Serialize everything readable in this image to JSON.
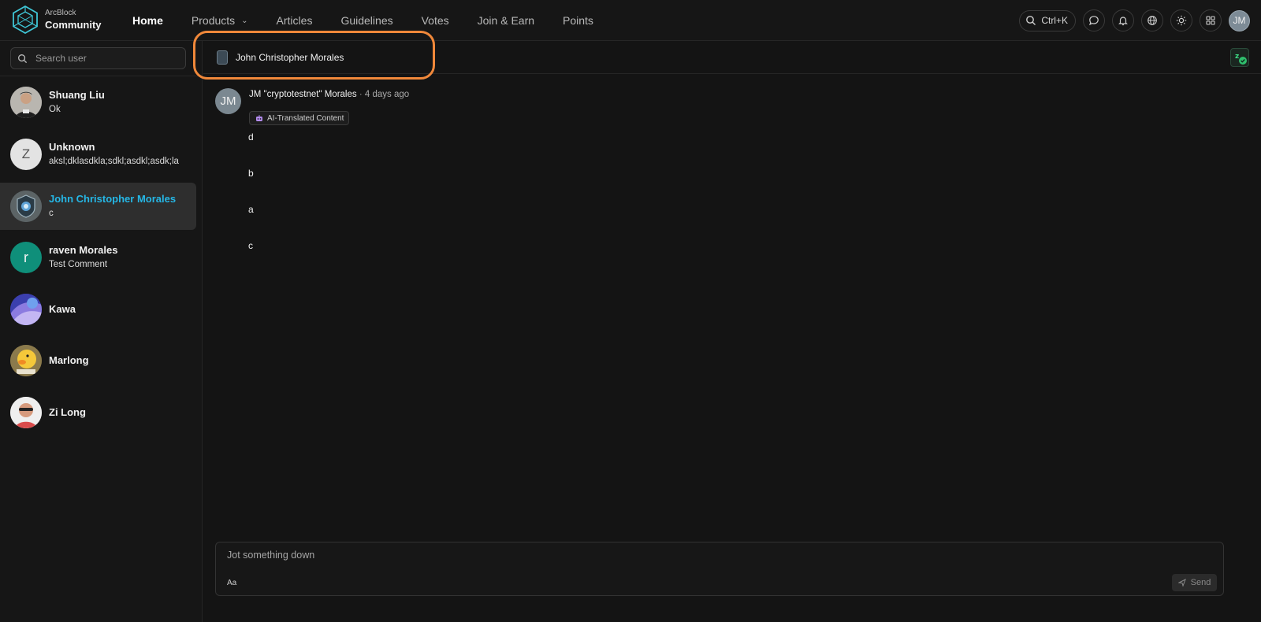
{
  "header": {
    "brand_top": "ArcBlock",
    "brand_bottom": "Community",
    "nav": [
      {
        "label": "Home",
        "active": true
      },
      {
        "label": "Products",
        "has_dropdown": true
      },
      {
        "label": "Articles"
      },
      {
        "label": "Guidelines"
      },
      {
        "label": "Votes"
      },
      {
        "label": "Join & Earn"
      },
      {
        "label": "Points"
      }
    ],
    "search_shortcut": "Ctrl+K",
    "user_initials": "JM",
    "icons": [
      "search-icon",
      "chat-icon",
      "bell-icon",
      "globe-icon",
      "sun-icon",
      "apps-grid-icon"
    ]
  },
  "sidebar": {
    "search_placeholder": "Search user",
    "contacts": [
      {
        "name": "Shuang Liu",
        "last": "Ok",
        "avatar": "photo"
      },
      {
        "name": "Unknown",
        "last": "aksl;dklasdkla;sdkl;asdkl;asdk;la",
        "avatar_letter": "Z"
      },
      {
        "name": "John Christopher Morales",
        "last": "c",
        "active": true,
        "avatar": "badge"
      },
      {
        "name": "raven Morales",
        "last": "Test Comment",
        "avatar_letter": "r"
      },
      {
        "name": "Kawa",
        "last": "",
        "avatar": "abstract"
      },
      {
        "name": "Marlong",
        "last": "",
        "avatar": "duck"
      },
      {
        "name": "Zi Long",
        "last": "",
        "avatar": "photo"
      }
    ]
  },
  "chat": {
    "title": "John Christopher Morales",
    "message": {
      "avatar_initials": "JM",
      "author": "JM \"cryptotestnet\" Morales",
      "separator": "·",
      "time": "4 days ago",
      "badge": "AI-Translated Content",
      "lines": [
        "d",
        "b",
        "a",
        "c"
      ]
    },
    "composer": {
      "placeholder": "Jot something down",
      "format_label": "Aa",
      "send_label": "Send"
    }
  },
  "colors": {
    "accent": "#25b7e6",
    "highlight": "#f0883a",
    "background": "#141414"
  }
}
